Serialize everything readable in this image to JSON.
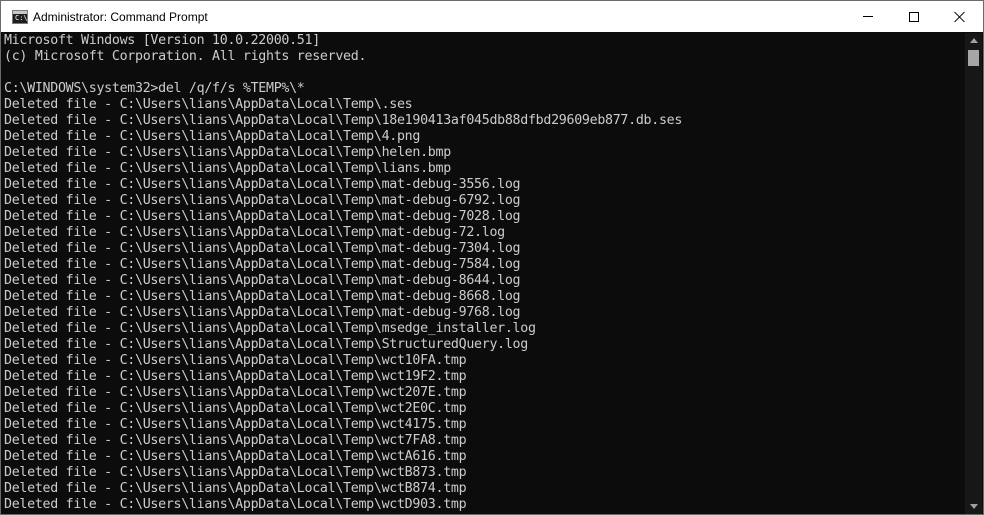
{
  "window": {
    "title": "Administrator: Command Prompt",
    "icon_label": "C:\\"
  },
  "controls": {
    "minimize": "minimize-icon",
    "maximize": "maximize-icon",
    "close": "close-icon"
  },
  "console": {
    "lines": [
      "Microsoft Windows [Version 10.0.22000.51]",
      "(c) Microsoft Corporation. All rights reserved.",
      "",
      "C:\\WINDOWS\\system32>del /q/f/s %TEMP%\\*",
      "Deleted file - C:\\Users\\lians\\AppData\\Local\\Temp\\.ses",
      "Deleted file - C:\\Users\\lians\\AppData\\Local\\Temp\\18e190413af045db88dfbd29609eb877.db.ses",
      "Deleted file - C:\\Users\\lians\\AppData\\Local\\Temp\\4.png",
      "Deleted file - C:\\Users\\lians\\AppData\\Local\\Temp\\helen.bmp",
      "Deleted file - C:\\Users\\lians\\AppData\\Local\\Temp\\lians.bmp",
      "Deleted file - C:\\Users\\lians\\AppData\\Local\\Temp\\mat-debug-3556.log",
      "Deleted file - C:\\Users\\lians\\AppData\\Local\\Temp\\mat-debug-6792.log",
      "Deleted file - C:\\Users\\lians\\AppData\\Local\\Temp\\mat-debug-7028.log",
      "Deleted file - C:\\Users\\lians\\AppData\\Local\\Temp\\mat-debug-72.log",
      "Deleted file - C:\\Users\\lians\\AppData\\Local\\Temp\\mat-debug-7304.log",
      "Deleted file - C:\\Users\\lians\\AppData\\Local\\Temp\\mat-debug-7584.log",
      "Deleted file - C:\\Users\\lians\\AppData\\Local\\Temp\\mat-debug-8644.log",
      "Deleted file - C:\\Users\\lians\\AppData\\Local\\Temp\\mat-debug-8668.log",
      "Deleted file - C:\\Users\\lians\\AppData\\Local\\Temp\\mat-debug-9768.log",
      "Deleted file - C:\\Users\\lians\\AppData\\Local\\Temp\\msedge_installer.log",
      "Deleted file - C:\\Users\\lians\\AppData\\Local\\Temp\\StructuredQuery.log",
      "Deleted file - C:\\Users\\lians\\AppData\\Local\\Temp\\wct10FA.tmp",
      "Deleted file - C:\\Users\\lians\\AppData\\Local\\Temp\\wct19F2.tmp",
      "Deleted file - C:\\Users\\lians\\AppData\\Local\\Temp\\wct207E.tmp",
      "Deleted file - C:\\Users\\lians\\AppData\\Local\\Temp\\wct2E0C.tmp",
      "Deleted file - C:\\Users\\lians\\AppData\\Local\\Temp\\wct4175.tmp",
      "Deleted file - C:\\Users\\lians\\AppData\\Local\\Temp\\wct7FA8.tmp",
      "Deleted file - C:\\Users\\lians\\AppData\\Local\\Temp\\wctA616.tmp",
      "Deleted file - C:\\Users\\lians\\AppData\\Local\\Temp\\wctB873.tmp",
      "Deleted file - C:\\Users\\lians\\AppData\\Local\\Temp\\wctB874.tmp",
      "Deleted file - C:\\Users\\lians\\AppData\\Local\\Temp\\wctD903.tmp"
    ]
  },
  "colors": {
    "console_bg": "#0c0c0c",
    "console_fg": "#cccccc",
    "titlebar_bg": "#ffffff"
  }
}
